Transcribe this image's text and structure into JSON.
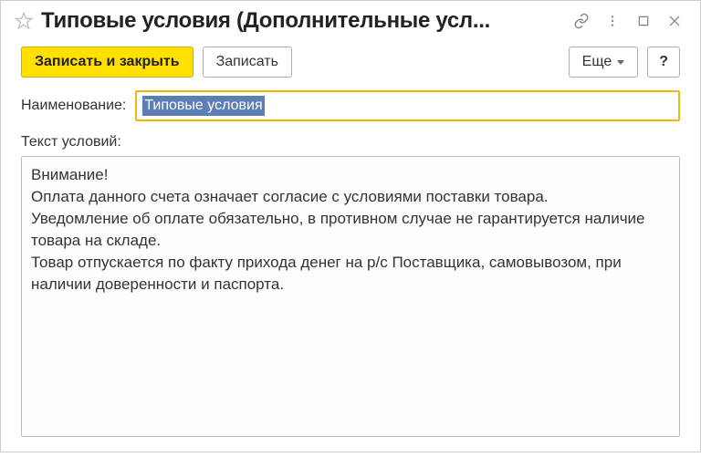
{
  "title": "Типовые условия (Дополнительные усл...",
  "toolbar": {
    "save_close_label": "Записать и закрыть",
    "save_label": "Записать",
    "more_label": "Еще",
    "help_label": "?"
  },
  "form": {
    "name_label": "Наименование:",
    "name_value": "Типовые условия",
    "text_label": "Текст условий:",
    "text_value": "Внимание!\nОплата данного счета означает согласие с условиями поставки товара.\nУведомление об оплате обязательно, в противном случае не гарантируется наличие товара на складе.\nТовар отпускается по факту прихода денег на р/с Поставщика, самовывозом, при наличии доверенности и паспорта."
  }
}
